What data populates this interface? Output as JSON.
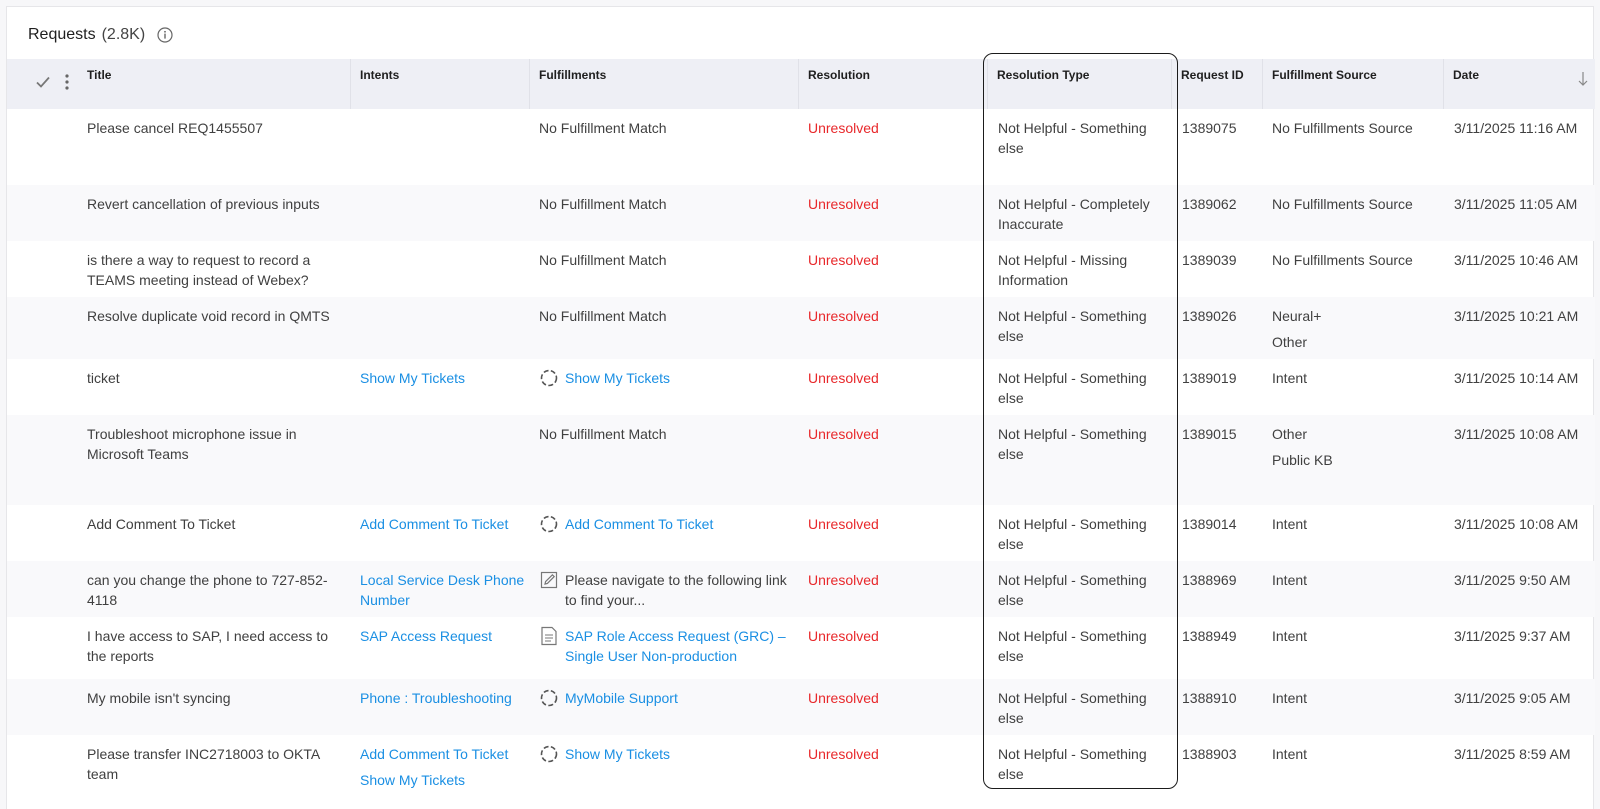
{
  "header": {
    "title": "Requests",
    "count": "(2.8K)",
    "info_icon": "info-circle-icon"
  },
  "columns": {
    "title": "Title",
    "intents": "Intents",
    "fulfillments": "Fulfillments",
    "resolution": "Resolution",
    "resolution_type": "Resolution Type",
    "request_id": "Request ID",
    "fulfillment_source": "Fulfillment Source",
    "date": "Date"
  },
  "header_icons": {
    "select_all": "check-icon",
    "column_menu": "kebab-icon",
    "sort": "arrow-down-icon"
  },
  "colors": {
    "link": "#1a8fe3",
    "unresolved": "#e8282b",
    "header_bg": "#eeeff5"
  },
  "rows": [
    {
      "title": "Please cancel REQ1455507",
      "intents": [],
      "fulfillment": {
        "text": "No Fulfillment Match",
        "icon": "",
        "is_link": false
      },
      "resolution": "Unresolved",
      "resolution_type": "Not Helpful - Something else",
      "request_id": "1389075",
      "sources": [
        "No Fulfillments Source"
      ],
      "date": "3/11/2025 11:16 AM"
    },
    {
      "title": "Revert cancellation of previous inputs",
      "intents": [],
      "fulfillment": {
        "text": "No Fulfillment Match",
        "icon": "",
        "is_link": false
      },
      "resolution": "Unresolved",
      "resolution_type": "Not Helpful - Completely Inaccurate",
      "request_id": "1389062",
      "sources": [
        "No Fulfillments Source"
      ],
      "date": "3/11/2025 11:05 AM"
    },
    {
      "title": "is there a way to request to record a TEAMS meeting instead of Webex?",
      "intents": [],
      "fulfillment": {
        "text": "No Fulfillment Match",
        "icon": "",
        "is_link": false
      },
      "resolution": "Unresolved",
      "resolution_type": "Not Helpful - Missing Information",
      "request_id": "1389039",
      "sources": [
        "No Fulfillments Source"
      ],
      "date": "3/11/2025 10:46 AM"
    },
    {
      "title": "Resolve duplicate void record in QMTS",
      "intents": [],
      "fulfillment": {
        "text": "No Fulfillment Match",
        "icon": "",
        "is_link": false
      },
      "resolution": "Unresolved",
      "resolution_type": "Not Helpful - Something else",
      "request_id": "1389026",
      "sources": [
        "Neural+",
        "Other"
      ],
      "date": "3/11/2025 10:21 AM"
    },
    {
      "title": "ticket",
      "intents": [
        "Show My Tickets"
      ],
      "fulfillment": {
        "text": "Show My Tickets",
        "icon": "workflow-cycle-icon",
        "is_link": true
      },
      "resolution": "Unresolved",
      "resolution_type": "Not Helpful - Something else",
      "request_id": "1389019",
      "sources": [
        "Intent"
      ],
      "date": "3/11/2025 10:14 AM"
    },
    {
      "title": "Troubleshoot microphone issue in Microsoft Teams",
      "intents": [],
      "fulfillment": {
        "text": "No Fulfillment Match",
        "icon": "",
        "is_link": false
      },
      "resolution": "Unresolved",
      "resolution_type": "Not Helpful - Something else",
      "request_id": "1389015",
      "sources": [
        "Other",
        "Public KB"
      ],
      "date": "3/11/2025 10:08 AM"
    },
    {
      "title": "Add Comment To Ticket",
      "intents": [
        "Add Comment To Ticket"
      ],
      "fulfillment": {
        "text": "Add Comment To Ticket",
        "icon": "workflow-cycle-icon",
        "is_link": true
      },
      "resolution": "Unresolved",
      "resolution_type": "Not Helpful - Something else",
      "request_id": "1389014",
      "sources": [
        "Intent"
      ],
      "date": "3/11/2025 10:08 AM"
    },
    {
      "title": "can you change the phone to 727-852-4118",
      "intents": [
        "Local Service Desk Phone Number"
      ],
      "fulfillment": {
        "text": "Please navigate to the following link to find your...",
        "icon": "edit-note-icon",
        "is_link": false
      },
      "resolution": "Unresolved",
      "resolution_type": "Not Helpful - Something else",
      "request_id": "1388969",
      "sources": [
        "Intent"
      ],
      "date": "3/11/2025 9:50 AM"
    },
    {
      "title": "I have access to SAP, I need access to the reports",
      "intents": [
        "SAP Access Request"
      ],
      "fulfillment": {
        "text": "SAP Role Access Request (GRC) – Single User Non-production",
        "icon": "document-icon",
        "is_link": true
      },
      "resolution": "Unresolved",
      "resolution_type": "Not Helpful - Something else",
      "request_id": "1388949",
      "sources": [
        "Intent"
      ],
      "date": "3/11/2025 9:37 AM"
    },
    {
      "title": "My mobile isn't syncing",
      "intents": [
        "Phone : Troubleshooting"
      ],
      "fulfillment": {
        "text": "MyMobile Support",
        "icon": "workflow-cycle-icon",
        "is_link": true
      },
      "resolution": "Unresolved",
      "resolution_type": "Not Helpful - Something else",
      "request_id": "1388910",
      "sources": [
        "Intent"
      ],
      "date": "3/11/2025 9:05 AM"
    },
    {
      "title": "Please transfer INC2718003 to OKTA team",
      "intents": [
        "Add Comment To Ticket",
        "Show My Tickets"
      ],
      "fulfillment": {
        "text": "Show My Tickets",
        "icon": "workflow-cycle-icon",
        "is_link": true
      },
      "resolution": "Unresolved",
      "resolution_type": "Not Helpful - Something else",
      "request_id": "1388903",
      "sources": [
        "Intent"
      ],
      "date": "3/11/2025 8:59 AM"
    }
  ]
}
